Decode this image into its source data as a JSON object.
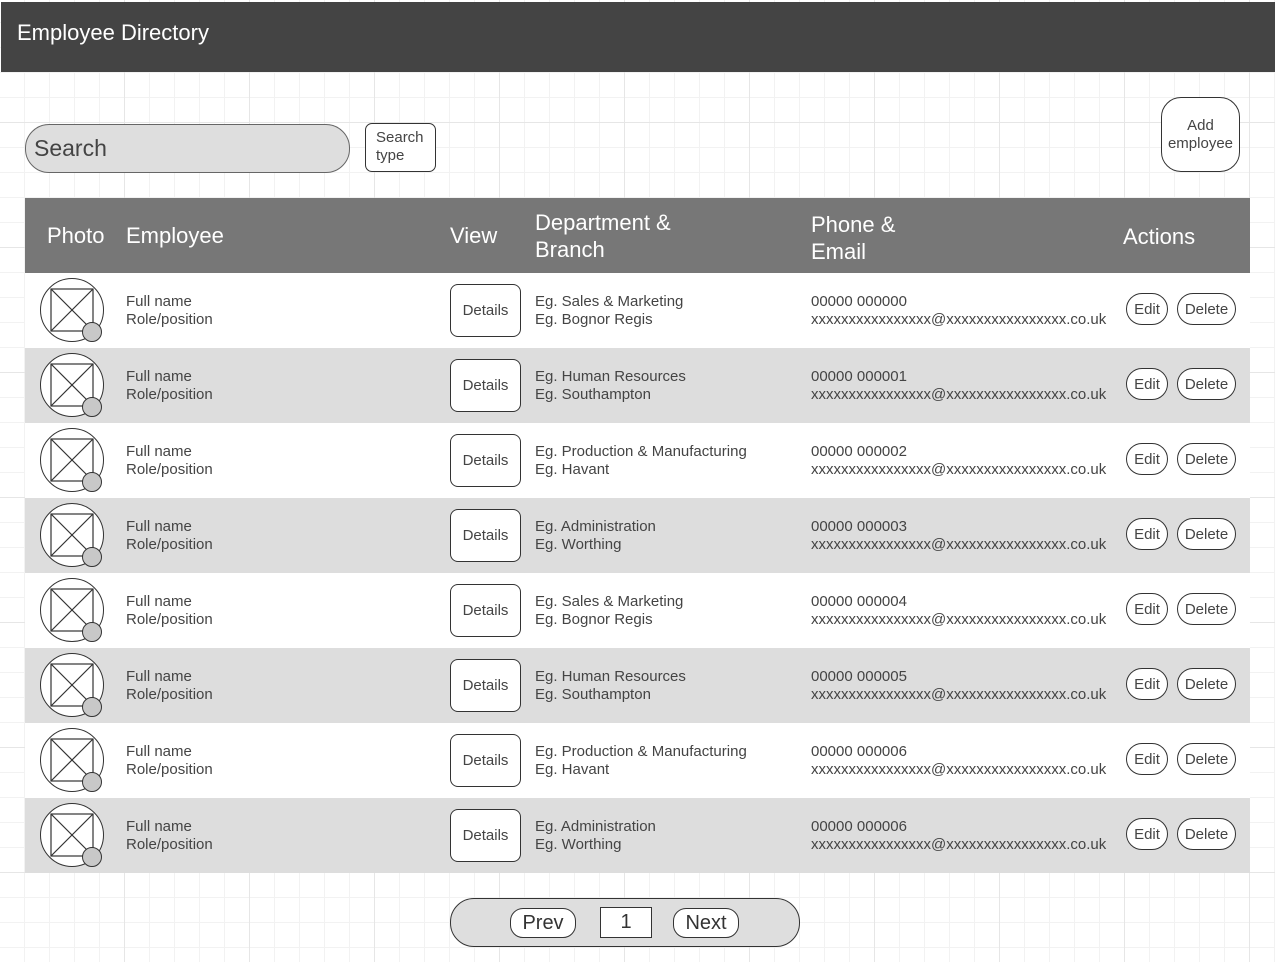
{
  "header": {
    "title": "Employee Directory"
  },
  "search": {
    "placeholder": "Search",
    "type_button": "Search type"
  },
  "add_button": "Add employee",
  "table": {
    "columns": {
      "photo": "Photo",
      "employee": "Employee",
      "view": "View",
      "department_line1": "Department &",
      "department_line2": "Branch",
      "phone_line1": "Phone &",
      "phone_line2": "Email",
      "actions": "Actions"
    },
    "rows": [
      {
        "name": "Full name",
        "role": "Role/position",
        "details": "Details",
        "department": "Eg. Sales & Marketing",
        "branch": "Eg. Bognor Regis",
        "phone": "00000 000000",
        "email": "xxxxxxxxxxxxxxxx@xxxxxxxxxxxxxxxx.co.uk",
        "edit": "Edit",
        "delete": "Delete"
      },
      {
        "name": "Full name",
        "role": "Role/position",
        "details": "Details",
        "department": "Eg. Human Resources",
        "branch": "Eg. Southampton",
        "phone": "00000 000001",
        "email": "xxxxxxxxxxxxxxxx@xxxxxxxxxxxxxxxx.co.uk",
        "edit": "Edit",
        "delete": "Delete"
      },
      {
        "name": "Full name",
        "role": "Role/position",
        "details": "Details",
        "department": "Eg. Production & Manufacturing",
        "branch": "Eg. Havant",
        "phone": "00000 000002",
        "email": "xxxxxxxxxxxxxxxx@xxxxxxxxxxxxxxxx.co.uk",
        "edit": "Edit",
        "delete": "Delete"
      },
      {
        "name": "Full name",
        "role": "Role/position",
        "details": "Details",
        "department": "Eg. Administration",
        "branch": "Eg. Worthing",
        "phone": "00000 000003",
        "email": "xxxxxxxxxxxxxxxx@xxxxxxxxxxxxxxxx.co.uk",
        "edit": "Edit",
        "delete": "Delete"
      },
      {
        "name": "Full name",
        "role": "Role/position",
        "details": "Details",
        "department": "Eg. Sales & Marketing",
        "branch": "Eg. Bognor Regis",
        "phone": "00000 000004",
        "email": "xxxxxxxxxxxxxxxx@xxxxxxxxxxxxxxxx.co.uk",
        "edit": "Edit",
        "delete": "Delete"
      },
      {
        "name": "Full name",
        "role": "Role/position",
        "details": "Details",
        "department": "Eg. Human Resources",
        "branch": "Eg. Southampton",
        "phone": "00000 000005",
        "email": "xxxxxxxxxxxxxxxx@xxxxxxxxxxxxxxxx.co.uk",
        "edit": "Edit",
        "delete": "Delete"
      },
      {
        "name": "Full name",
        "role": "Role/position",
        "details": "Details",
        "department": "Eg. Production & Manufacturing",
        "branch": "Eg. Havant",
        "phone": "00000 000006",
        "email": "xxxxxxxxxxxxxxxx@xxxxxxxxxxxxxxxx.co.uk",
        "edit": "Edit",
        "delete": "Delete"
      },
      {
        "name": "Full name",
        "role": "Role/position",
        "details": "Details",
        "department": "Eg. Administration",
        "branch": "Eg. Worthing",
        "phone": "00000 000006",
        "email": "xxxxxxxxxxxxxxxx@xxxxxxxxxxxxxxxx.co.uk",
        "edit": "Edit",
        "delete": "Delete"
      }
    ]
  },
  "pagination": {
    "prev": "Prev",
    "page": "1",
    "next": "Next"
  },
  "icons": {
    "photo": "image-placeholder-icon",
    "status": "status-dot-icon"
  },
  "colors": {
    "header_bg": "#444444",
    "table_header_bg": "#777777",
    "row_alt_bg": "#dddddd"
  }
}
